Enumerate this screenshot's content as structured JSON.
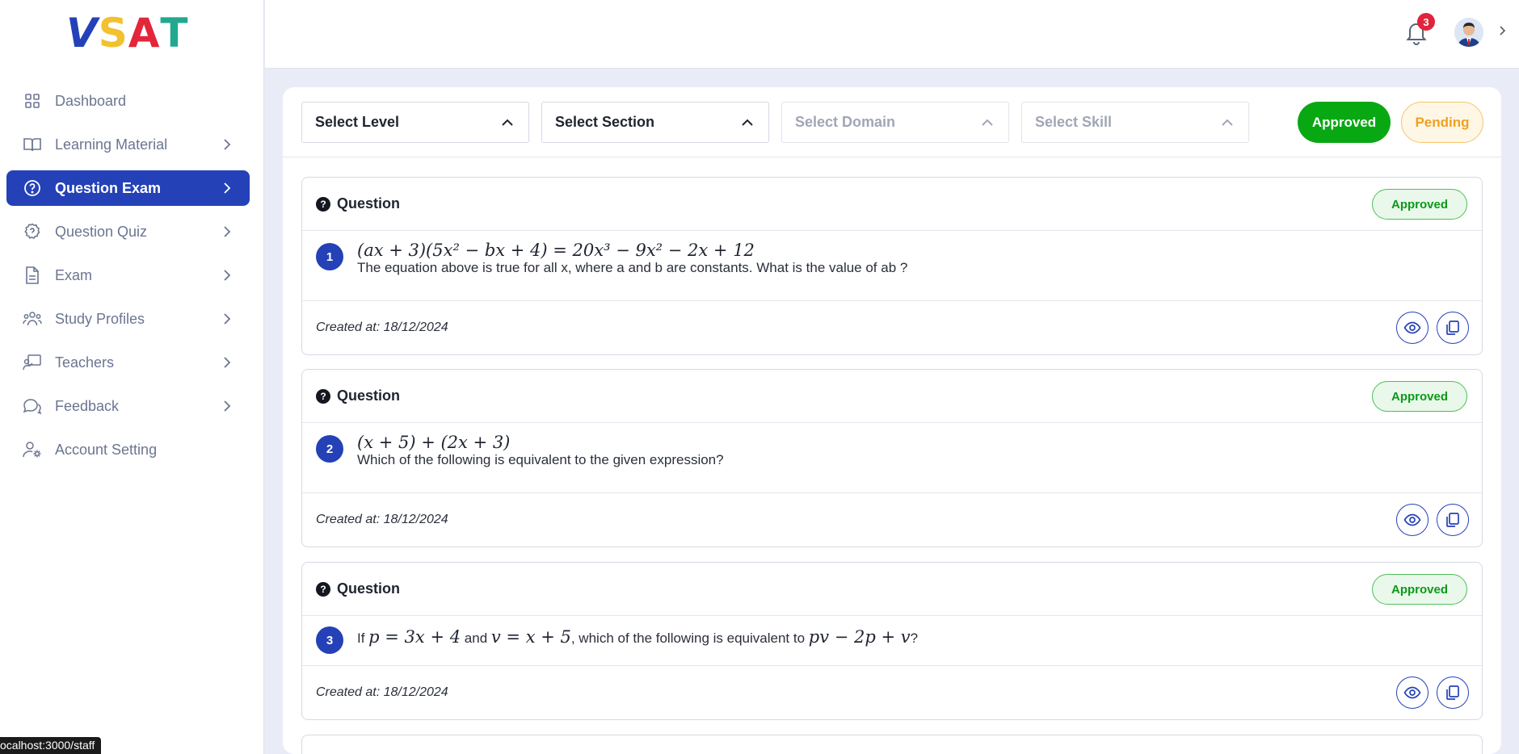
{
  "logo": {
    "letters": [
      "V",
      "S",
      "A",
      "T"
    ],
    "colors": [
      "#2441b8",
      "#f2c12e",
      "#e3263a",
      "#22a88f"
    ]
  },
  "sidebar": {
    "items": [
      {
        "label": "Dashboard",
        "icon": "grid-icon",
        "chevron": false,
        "active": false
      },
      {
        "label": "Learning Material",
        "icon": "book-icon",
        "chevron": true,
        "active": false
      },
      {
        "label": "Question Exam",
        "icon": "question-circle-icon",
        "chevron": true,
        "active": true
      },
      {
        "label": "Question Quiz",
        "icon": "quiz-icon",
        "chevron": true,
        "active": false
      },
      {
        "label": "Exam",
        "icon": "document-icon",
        "chevron": true,
        "active": false
      },
      {
        "label": "Study Profiles",
        "icon": "users-icon",
        "chevron": true,
        "active": false
      },
      {
        "label": "Teachers",
        "icon": "teacher-icon",
        "chevron": true,
        "active": false
      },
      {
        "label": "Feedback",
        "icon": "chat-icon",
        "chevron": true,
        "active": false
      },
      {
        "label": "Account Setting",
        "icon": "user-gear-icon",
        "chevron": false,
        "active": false
      }
    ]
  },
  "header": {
    "notification_count": "3"
  },
  "filters": {
    "level": "Select Level",
    "section": "Select Section",
    "domain": "Select Domain",
    "skill": "Select Skill",
    "approved_label": "Approved",
    "pending_label": "Pending"
  },
  "questions": [
    {
      "header": "Question",
      "status": "Approved",
      "number": "1",
      "math": "(ax + 3)(5x² − bx + 4) = 20x³ − 9x² − 2x + 12",
      "text": "The equation above is true for all x, where a and b are constants. What is the value of ab ?",
      "created": "Created at: 18/12/2024"
    },
    {
      "header": "Question",
      "status": "Approved",
      "number": "2",
      "math": "(x + 5) + (2x + 3)",
      "text": "Which of the following is equivalent to the given expression?",
      "created": "Created at: 18/12/2024"
    },
    {
      "header": "Question",
      "status": "Approved",
      "number": "3",
      "inline": {
        "p1": "If ",
        "m1": "p = 3x + 4",
        "p2": " and ",
        "m2": "v = x + 5",
        "p3": ", which of the following is equivalent to ",
        "m3": "pv − 2p + v",
        "p4": "?"
      },
      "created": "Created at: 18/12/2024"
    }
  ],
  "status_bar": {
    "url": "ocalhost:3000/staff"
  }
}
